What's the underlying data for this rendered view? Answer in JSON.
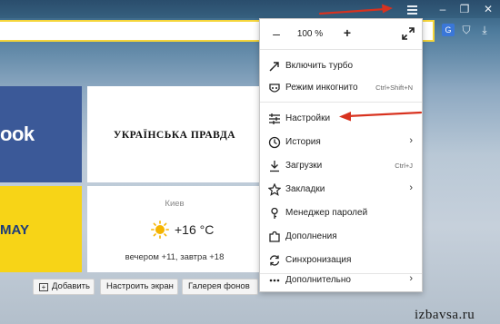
{
  "window": {
    "min_glyph": "–",
    "max_glyph": "❐",
    "close_glyph": "✕"
  },
  "address_bar": {
    "value": "",
    "placeholder": ""
  },
  "extensions": [
    {
      "name": "translate-icon",
      "glyph": "G"
    },
    {
      "name": "shield-icon",
      "glyph": "⛉"
    },
    {
      "name": "download-icon",
      "glyph": "⤓"
    }
  ],
  "tiles": {
    "facebook": "ook",
    "pravda": "УКРАЇНСЬКА ПРАВДА",
    "yellow": "MAY",
    "weather": {
      "city": "Киев",
      "temp": "+16 °C",
      "forecast": "вечером +11, завтра +18"
    }
  },
  "bottom_bar": {
    "add": "Добавить",
    "setup": "Настроить экран",
    "gallery": "Галерея фонов"
  },
  "menu": {
    "zoom": {
      "minus": "–",
      "value": "100 %",
      "plus": "+"
    },
    "items": [
      {
        "label": "Включить турбо",
        "icon": "rocket-icon",
        "shortcut": ""
      },
      {
        "label": "Режим инкогнито",
        "icon": "incognito-icon",
        "shortcut": "Ctrl+Shift+N"
      },
      {
        "label": "Настройки",
        "icon": "settings-sliders-icon",
        "shortcut": ""
      },
      {
        "label": "История",
        "icon": "clock-icon",
        "shortcut": "",
        "submenu": true
      },
      {
        "label": "Загрузки",
        "icon": "download-arrow-icon",
        "shortcut": "Ctrl+J"
      },
      {
        "label": "Закладки",
        "icon": "star-icon",
        "shortcut": "",
        "submenu": true
      },
      {
        "label": "Менеджер паролей",
        "icon": "key-icon",
        "shortcut": ""
      },
      {
        "label": "Дополнения",
        "icon": "puzzle-icon",
        "shortcut": ""
      },
      {
        "label": "Синхронизация",
        "icon": "sync-icon",
        "shortcut": ""
      },
      {
        "label": "Дополнительно",
        "icon": "more-dots-icon",
        "shortcut": "",
        "submenu": true
      }
    ],
    "submenu_arrow": "›"
  },
  "colors": {
    "accent_yellow": "#f5d53a",
    "facebook_blue": "#3b5998",
    "annotation_red": "#d8321f"
  },
  "watermark": "izbavsa.ru"
}
